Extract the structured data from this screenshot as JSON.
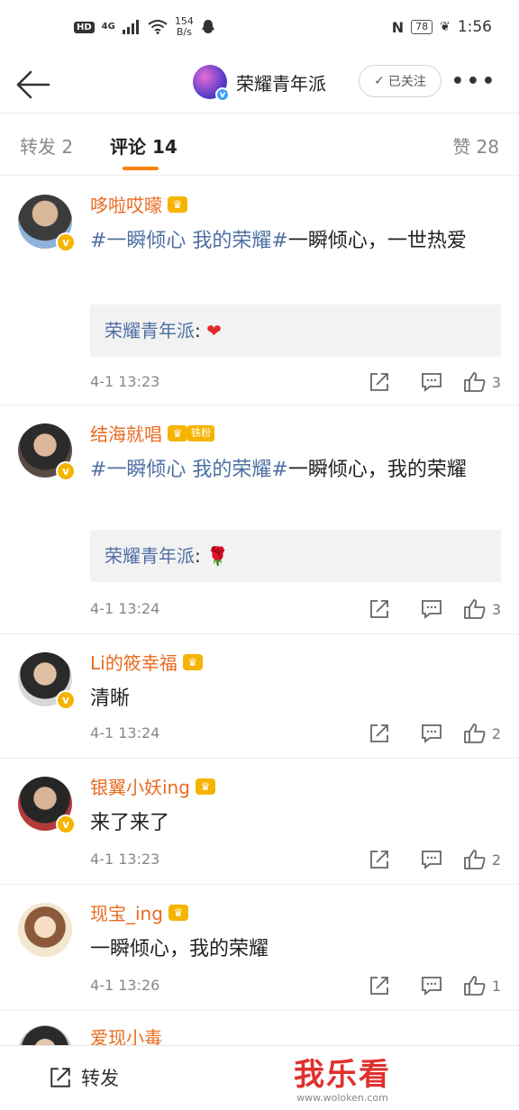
{
  "status_bar": {
    "hd": "HD",
    "signal": "4G",
    "speed_value": "154",
    "speed_unit": "B/s",
    "battery": "78",
    "time": "1:56"
  },
  "nav": {
    "title": "荣耀青年派",
    "follow_label": "已关注"
  },
  "tabs": {
    "repost": "转发 2",
    "comments": "评论 14",
    "likes": "赞 28"
  },
  "comments": [
    {
      "user": "哆啦哎曚",
      "fan_badge": "",
      "tag": "#一瞬倾心 我的荣耀#",
      "text": "一瞬倾心，一世热爱",
      "reply_name": "荣耀青年派",
      "reply_text": "❤",
      "time": "4-1 13:23",
      "likes": "3"
    },
    {
      "user": "结海就唱",
      "fan_badge": "铁粉",
      "tag": "#一瞬倾心 我的荣耀#",
      "text": "一瞬倾心，我的荣耀",
      "reply_name": "荣耀青年派",
      "reply_text": "🌹",
      "time": "4-1 13:24",
      "likes": "3"
    },
    {
      "user": "Li的筱幸福",
      "text": "清晰",
      "time": "4-1 13:24",
      "likes": "2"
    },
    {
      "user": "银翼小妖ing",
      "text": "来了来了",
      "time": "4-1 13:23",
      "likes": "2"
    },
    {
      "user": "现宝_ing",
      "text": "一瞬倾心，我的荣耀",
      "time": "4-1 13:26",
      "likes": "1"
    },
    {
      "user": "爱现小毒"
    }
  ],
  "bottom": {
    "repost_label": "转发",
    "watermark_logo": "我乐看",
    "watermark_url": "www.woloken.com"
  },
  "colors": {
    "username": "#e86b1f",
    "topic_link": "#4e6fa3",
    "tab_indicator": "#ff8200",
    "verified_badge": "#f5b400"
  },
  "icons": [
    "back-arrow-icon",
    "more-icon",
    "share-icon",
    "comment-icon",
    "like-icon",
    "check-icon",
    "crown-icon",
    "verified-icon"
  ]
}
